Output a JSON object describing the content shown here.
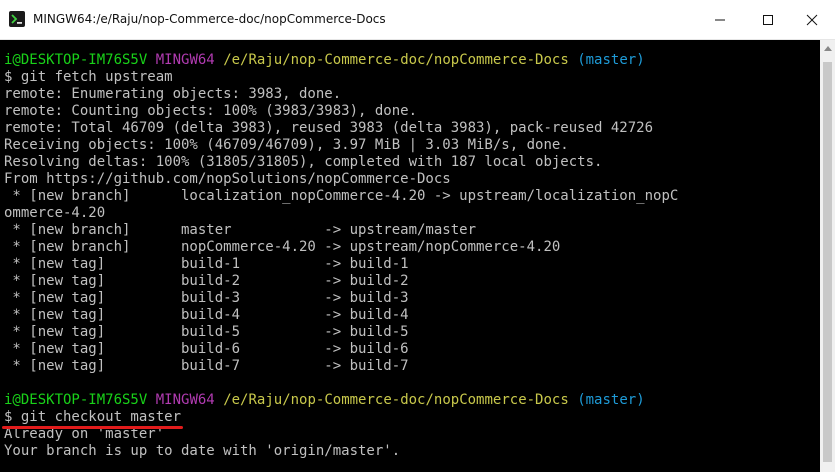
{
  "window": {
    "title": "MINGW64:/e/Raju/nop-Commerce-doc/nopCommerce-Docs",
    "ghost_title": "MINGW64:/e/Raju/nop-Commerce-doc/nopCommerce-Docs (master)"
  },
  "prompt1": {
    "user": "i@DESKTOP-IM76S5V",
    "shell": "MINGW64",
    "path": "/e/Raju/nop-Commerce-doc/nopCommerce-Docs",
    "branch": "(master)"
  },
  "cmd1": "$ git fetch upstream",
  "fetch_output": [
    "remote: Enumerating objects: 3983, done.",
    "remote: Counting objects: 100% (3983/3983), done.",
    "remote: Total 46709 (delta 3983), reused 3983 (delta 3983), pack-reused 42726",
    "Receiving objects: 100% (46709/46709), 3.97 MiB | 3.03 MiB/s, done.",
    "Resolving deltas: 100% (31805/31805), completed with 187 local objects.",
    "From https://github.com/nopSolutions/nopCommerce-Docs",
    " * [new branch]      localization_nopCommerce-4.20 -> upstream/localization_nopC",
    "ommerce-4.20",
    " * [new branch]      master           -> upstream/master",
    " * [new branch]      nopCommerce-4.20 -> upstream/nopCommerce-4.20",
    " * [new tag]         build-1          -> build-1",
    " * [new tag]         build-2          -> build-2",
    " * [new tag]         build-3          -> build-3",
    " * [new tag]         build-4          -> build-4",
    " * [new tag]         build-5          -> build-5",
    " * [new tag]         build-6          -> build-6",
    " * [new tag]         build-7          -> build-7"
  ],
  "prompt2": {
    "user": "i@DESKTOP-IM76S5V",
    "shell": "MINGW64",
    "path": "/e/Raju/nop-Commerce-doc/nopCommerce-Docs",
    "branch": "(master)"
  },
  "cmd2": "$ git checkout master",
  "checkout_output": [
    "Already on 'master'",
    "Your branch is up to date with 'origin/master'."
  ],
  "colors": {
    "user": "#19d219",
    "shell": "#b13bb1",
    "path": "#c8c84b",
    "branch": "#1e9bd7",
    "text": "#c0c0c0",
    "underline": "#e11b1b"
  },
  "icons": [
    "mingw-app-icon",
    "minimize-icon",
    "maximize-icon",
    "close-icon"
  ]
}
